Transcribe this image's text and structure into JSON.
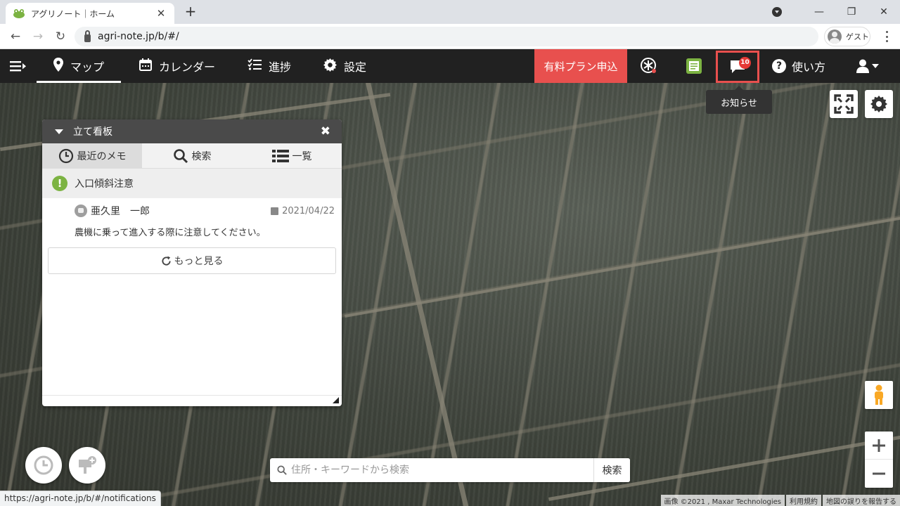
{
  "browser": {
    "tab_title": "アグリノート｜ホーム",
    "tab_close": "✕",
    "new_tab": "+",
    "url": "agri-note.jp/b/#/",
    "profile_label": "ゲスト",
    "status_url": "https://agri-note.jp/b/#/notifications"
  },
  "nav": {
    "items": [
      {
        "label": "マップ",
        "icon": "map-pin-icon",
        "active": true
      },
      {
        "label": "カレンダー",
        "icon": "calendar-icon"
      },
      {
        "label": "進捗",
        "icon": "checklist-icon"
      },
      {
        "label": "設定",
        "icon": "gear-icon"
      }
    ],
    "paid_plan": "有料プラン申込",
    "notifications_count": "10",
    "help": "使い方"
  },
  "tooltip": "お知らせ",
  "panel": {
    "title": "立て看板",
    "tabs": [
      {
        "label": "最近のメモ",
        "icon": "clock-icon",
        "active": true
      },
      {
        "label": "検索",
        "icon": "search-icon"
      },
      {
        "label": "一覧",
        "icon": "list-icon"
      }
    ],
    "memo": {
      "title": "入口傾斜注意",
      "author": "亜久里　一郎",
      "date": "2021/04/22",
      "body": "農機に乗って進入する際に注意してください。"
    },
    "more": "もっと見る"
  },
  "search": {
    "placeholder": "住所・キーワードから検索",
    "button": "検索"
  },
  "attribution": {
    "imagery": "画像 ©2021 , Maxar Technologies",
    "terms": "利用規約",
    "report": "地図の誤りを報告する"
  },
  "colors": {
    "navbar": "#212121",
    "paid_plan": "#e8504e",
    "memo_accent": "#7cb342",
    "zoom": "#555555"
  }
}
